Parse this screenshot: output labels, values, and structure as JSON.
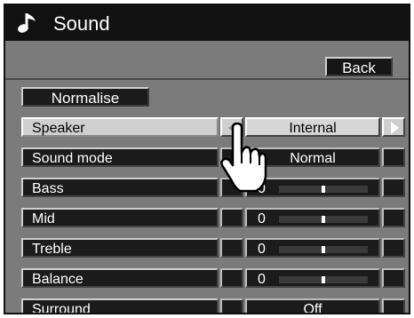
{
  "window": {
    "title": "Sound",
    "icon": "music-note-icon"
  },
  "buttons": {
    "back": "Back",
    "normalise": "Normalise"
  },
  "rows": [
    {
      "label": "Speaker",
      "value": "Internal",
      "selected": true
    },
    {
      "label": "Sound mode",
      "value": "Normal"
    },
    {
      "label": "Bass",
      "value": "0",
      "level": 0.5
    },
    {
      "label": "Mid",
      "value": "0",
      "level": 0.5
    },
    {
      "label": "Treble",
      "value": "0",
      "level": 0.5
    },
    {
      "label": "Balance",
      "value": "0",
      "level": 0.5
    },
    {
      "label": "Surround",
      "value": "Off"
    }
  ],
  "colors": {
    "panel": "#7b7b7b",
    "title_bar": "#111111",
    "selected_row": "#cfcfcf"
  }
}
